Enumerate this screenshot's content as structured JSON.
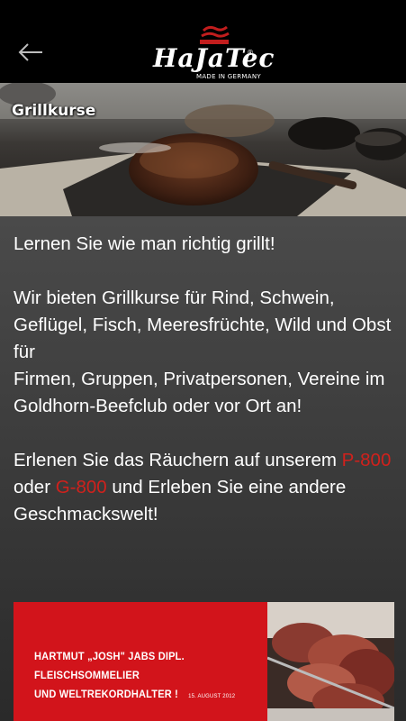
{
  "header": {
    "back_label": "Back",
    "logo_text": "HaJaTec",
    "logo_reg": "®",
    "logo_sub": "MADE IN GERMANY"
  },
  "hero": {
    "title": "Grillkurse"
  },
  "content": {
    "p1": "Lernen Sie wie man richtig grillt!",
    "p2": "Wir bieten Grillkurse für Rind, Schwein, Geflügel, Fisch, Meeresfrüchte, Wild und Obst für",
    "p3": "Firmen, Gruppen, Privatpersonen, Vereine im Goldhorn-Beefclub oder vor Ort an!",
    "p4_a": "Erlenen Sie das Räuchern auf unserem ",
    "p4_p800": "P-800",
    "p4_b": " oder ",
    "p4_g800": "G-800",
    "p4_c": " und Erleben Sie eine andere Geschmackswelt!"
  },
  "banner": {
    "line1": "HARTMUT „JOSH\" JABS DIPL. FLEISCHSOMMELIER",
    "line2": "UND WELTREKORDHALTER !",
    "date": "15. AUGUST 2012"
  },
  "colors": {
    "accent_red": "#d0211c",
    "banner_red": "#d2141b"
  }
}
